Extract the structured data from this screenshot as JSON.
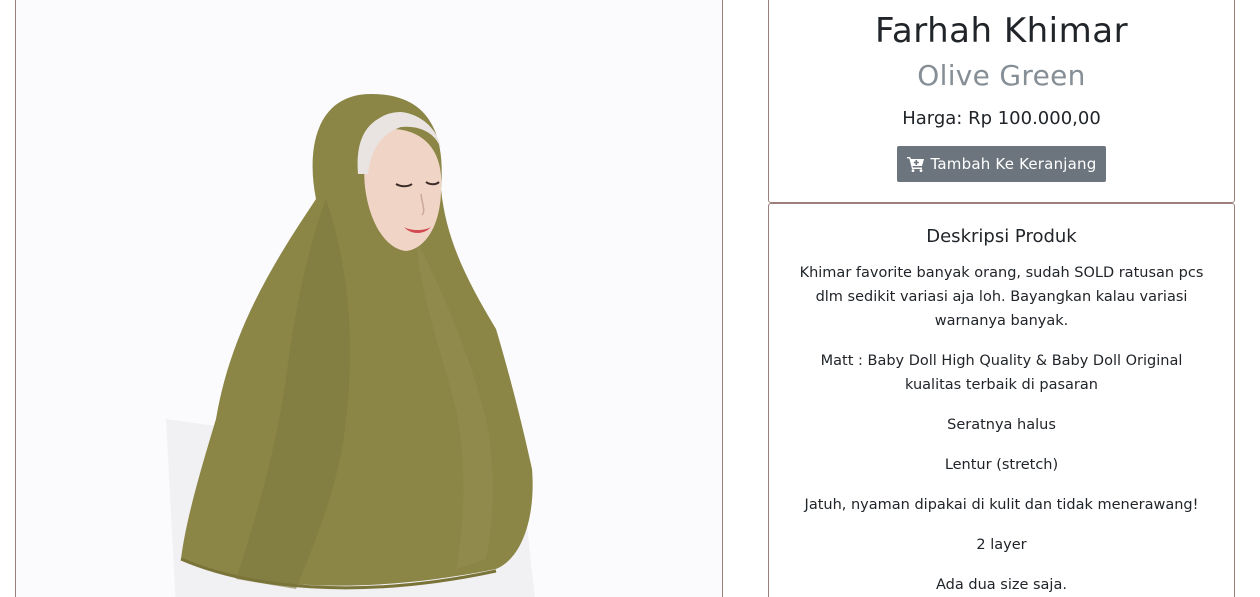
{
  "product": {
    "name": "Farhah Khimar",
    "variant": "Olive Green",
    "price_text": "Harga: Rp 100.000,00",
    "add_to_cart_label": "Tambah Ke Keranjang",
    "cart_icon": "cart-icon"
  },
  "colors": {
    "button_bg": "#6c757d",
    "variant_text": "#868e96",
    "card_border": "#9c7f7a",
    "hijab": "#8a8545"
  },
  "description": {
    "heading": "Deskripsi Produk",
    "paragraphs": [
      "Khimar favorite banyak orang, sudah SOLD ratusan pcs dlm sedikit variasi aja loh. Bayangkan kalau variasi warnanya banyak.",
      "Matt : Baby Doll High Quality & Baby Doll Original kualitas terbaik di pasaran",
      "Seratnya halus",
      "Lentur (stretch)",
      "Jatuh, nyaman dipakai di kulit dan tidak menerawang!",
      "2 layer",
      "Ada dua size saja."
    ]
  }
}
